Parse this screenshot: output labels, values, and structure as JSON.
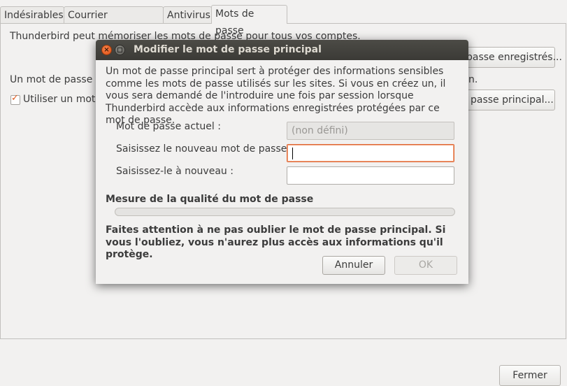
{
  "tabs": [
    "Indésirables",
    "Courrier frauduleux",
    "Antivirus",
    "Mots de passe"
  ],
  "background": {
    "line1": "Thunderbird peut mémoriser les mots de passe pour tous vos comptes.",
    "saved_passwords_button": "passe enregistrés...",
    "line2": "Un mot de passe p",
    "line2_end": "n.",
    "checkbox_label": "Utiliser un mot d",
    "master_password_button": "passe principal...",
    "close_button": "Fermer"
  },
  "dialog": {
    "title": "Modifier le mot de passe principal",
    "intro": "Un mot de passe principal sert à protéger des informations sensibles comme les mots de passe utilisés sur les sites. Si vous en créez un, il vous sera demandé de l'introduire une fois par session lorsque Thunderbird accède aux informations enregistrées protégées par ce mot de passe.",
    "current_label": "Mot de passe actuel :",
    "current_value": "(non défini)",
    "new_label": "Saisissez le nouveau mot de passe :",
    "new_value": "",
    "confirm_label": "Saisissez-le à nouveau :",
    "confirm_value": "",
    "quality_heading": "Mesure de la qualité du mot de passe",
    "quality_level": 0,
    "warning": "Faites attention à ne pas oublier le mot de passe principal. Si vous l'oubliez, vous n'aurez plus accès aux informations qu'il protège.",
    "cancel": "Annuler",
    "ok": "OK"
  },
  "colors": {
    "accent": "#e05a1f",
    "titlebar": "#3b3a36"
  }
}
